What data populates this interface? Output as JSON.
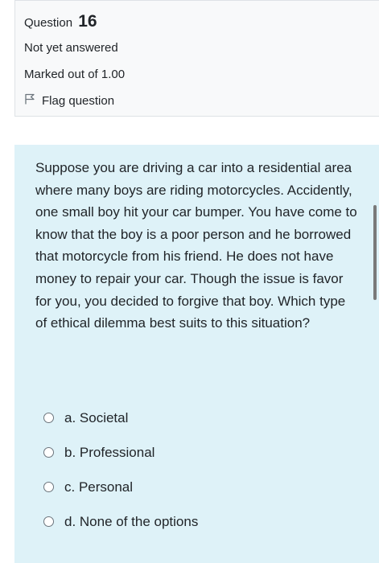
{
  "info": {
    "question_label": "Question",
    "question_number": "16",
    "state": "Not yet answered",
    "grade": "Marked out of 1.00",
    "flag_label": "Flag question"
  },
  "question": {
    "text": "Suppose you are driving a car into a residential area where many boys are riding motorcycles. Accidently, one small boy hit your car bumper. You have come to know that the boy is a poor person and he borrowed that motorcycle from his friend. He does not have money to repair your car. Though the issue is favor for you, you decided to forgive that boy. Which type of ethical dilemma best suits to this situation?"
  },
  "answers": [
    {
      "label": "a. Societal"
    },
    {
      "label": "b. Professional"
    },
    {
      "label": "c. Personal"
    },
    {
      "label": "d. None of the options"
    }
  ]
}
